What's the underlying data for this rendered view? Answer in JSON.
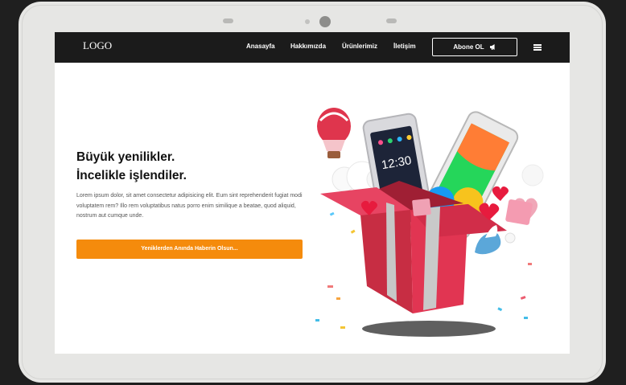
{
  "header": {
    "logo": "LOGO",
    "nav": [
      "Anasayfa",
      "Hakkımızda",
      "Ürünlerimiz",
      "İletişim"
    ],
    "subscribe_label": "Abone OL"
  },
  "hero": {
    "headline_line1": "Büyük yenilikler.",
    "headline_line2": "İncelikle işlendiler.",
    "body": "Lorem ipsum dolor, sit amet consectetur adipisicing elit. Eum sint reprehenderit fugiat modi voluptatem rem? Illo rem voluptatibus natus porro enim similique a beatae, quod aliquid, nostrum aut cumque unde.",
    "cta_label": "Yeniklerden Anında Haberin Olsun...",
    "phone_time": "12:30"
  },
  "colors": {
    "accent": "#f58b0c",
    "nav_background": "#1b1b1b",
    "gift_red": "#d42f48"
  },
  "icons": {
    "subscribe": "megaphone-icon",
    "menu": "hamburger-menu-icon"
  }
}
